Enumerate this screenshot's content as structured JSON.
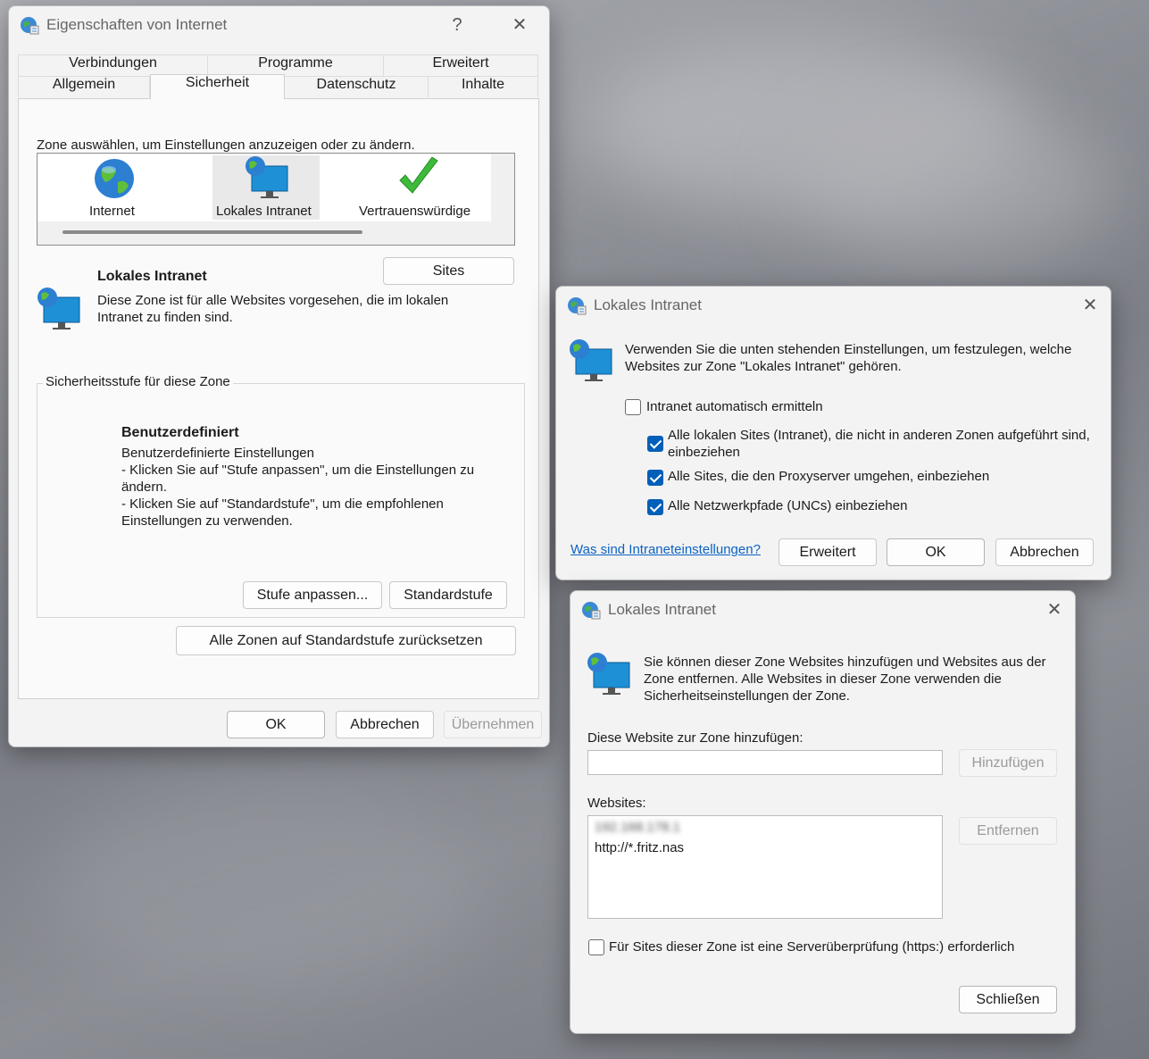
{
  "colors": {
    "accent": "#005fb8",
    "link": "#0b63c4",
    "globe_blue": "#2c7fd1",
    "check_green": "#3dba3a"
  },
  "main": {
    "title": "Eigenschaften von Internet",
    "help_glyph": "?",
    "close_glyph": "✕",
    "tabs_row1": [
      "Verbindungen",
      "Programme",
      "Erweitert"
    ],
    "tabs_row2": [
      "Allgemein",
      "Sicherheit",
      "Datenschutz",
      "Inhalte"
    ],
    "zone_prompt": "Zone auswählen, um Einstellungen anzuzeigen oder zu ändern.",
    "zones": [
      {
        "label": "Internet",
        "icon": "globe-icon"
      },
      {
        "label": "Lokales Intranet",
        "icon": "intranet-icon"
      },
      {
        "label": "Vertrauenswürdige",
        "icon": "checkmark-icon"
      }
    ],
    "zone_heading": "Lokales Intranet",
    "zone_desc": "Diese Zone ist für alle Websites vorgesehen, die im lokalen Intranet zu finden sind.",
    "sites_button": "Sites",
    "level_group": "Sicherheitsstufe für diese Zone",
    "level_title": "Benutzerdefiniert",
    "level_lines": [
      "Benutzerdefinierte Einstellungen",
      "- Klicken Sie auf \"Stufe anpassen\", um die Einstellungen zu",
      "ändern.",
      "- Klicken Sie auf \"Standardstufe\", um die empfohlenen",
      "Einstellungen zu verwenden."
    ],
    "custom_level_button": "Stufe anpassen...",
    "default_level_button": "Standardstufe",
    "reset_all_button": "Alle Zonen auf Standardstufe zurücksetzen",
    "ok": "OK",
    "cancel": "Abbrechen",
    "apply": "Übernehmen"
  },
  "intranet_dialog": {
    "title": "Lokales Intranet",
    "close_glyph": "✕",
    "desc": "Verwenden Sie die unten stehenden Einstellungen, um festzulegen, welche Websites zur Zone \"Lokales Intranet\" gehören.",
    "auto_detect": {
      "label": "Intranet automatisch ermitteln",
      "checked": false
    },
    "options": [
      {
        "label": "Alle lokalen Sites (Intranet), die nicht in anderen Zonen aufgeführt sind, einbeziehen",
        "checked": true
      },
      {
        "label": "Alle Sites, die den Proxyserver umgehen, einbeziehen",
        "checked": true
      },
      {
        "label": "Alle Netzwerkpfade (UNCs) einbeziehen",
        "checked": true
      }
    ],
    "help_link": "Was sind Intraneteinstellungen?",
    "advanced": "Erweitert",
    "ok": "OK",
    "cancel": "Abbrechen"
  },
  "sites_dialog": {
    "title": "Lokales Intranet",
    "close_glyph": "✕",
    "desc": "Sie können dieser Zone Websites hinzufügen und Websites aus der Zone entfernen. Alle Websites in dieser Zone verwenden die Sicherheitseinstellungen der Zone.",
    "add_label": "Diese Website zur Zone hinzufügen:",
    "add_value": "",
    "add_button": "Hinzufügen",
    "websites_label": "Websites:",
    "websites": [
      "192.168.178.1",
      "http://*.fritz.nas"
    ],
    "remove_button": "Entfernen",
    "https_check": {
      "label": "Für Sites dieser Zone ist eine Serverüberprüfung (https:) erforderlich",
      "checked": false
    },
    "close_button": "Schließen"
  }
}
